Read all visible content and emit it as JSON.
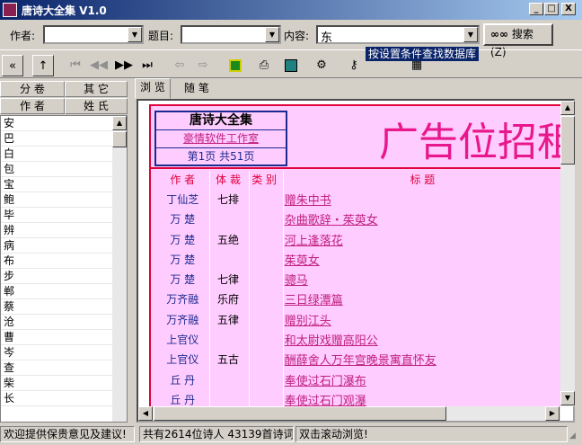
{
  "window": {
    "title": "唐诗大全集 V1.0",
    "min": "_",
    "max": "□",
    "close": "X"
  },
  "search": {
    "author_label": "作者:",
    "author_value": "",
    "title_label": "题目:",
    "title_value": "",
    "content_label": "内容:",
    "content_value": "东",
    "button_label": "搜索 (Z)",
    "tooltip": "按设置条件查找数据库"
  },
  "toolbar": {
    "icons": [
      "back-icon",
      "up-icon",
      "first-icon",
      "prev-icon",
      "next-icon",
      "last-icon",
      "nav-back-icon",
      "nav-forward-icon",
      "book-icon",
      "print-icon",
      "network-icon",
      "gear-icon",
      "key-icon",
      "calendar-icon"
    ]
  },
  "left_panel": {
    "tab1a": "分  卷",
    "tab1b": "其  它",
    "tab2a": "作  者",
    "tab2b": "姓  氏",
    "chars": [
      "安",
      "巴",
      "白",
      "包",
      "宝",
      "鲍",
      "毕",
      "辨",
      "病",
      "布",
      "步",
      "郸",
      "蔡",
      "沧",
      "曹",
      "岑",
      "查",
      "柴",
      "长"
    ]
  },
  "right_tabs": {
    "browse": "浏 览",
    "notes": "随 笔"
  },
  "brand": {
    "title": "唐诗大全集",
    "studio": "豪情软件工作室",
    "page": "第1页 共51页"
  },
  "ad_text": "广告位招租",
  "table": {
    "headers": [
      "作 者",
      "体 裁",
      "类 别",
      "标   题"
    ],
    "rows": [
      {
        "author": "丁仙芝",
        "form": "七排",
        "cat": "",
        "title": "赠朱中书"
      },
      {
        "author": "万  楚",
        "form": "",
        "cat": "",
        "title": "杂曲歌辞・茱萸女"
      },
      {
        "author": "万  楚",
        "form": "五绝",
        "cat": "",
        "title": "河上逢落花"
      },
      {
        "author": "万  楚",
        "form": "",
        "cat": "",
        "title": "茱萸女"
      },
      {
        "author": "万  楚",
        "form": "七律",
        "cat": "",
        "title": "骢马"
      },
      {
        "author": "万齐融",
        "form": "乐府",
        "cat": "",
        "title": "三日绿潭篇"
      },
      {
        "author": "万齐融",
        "form": "五律",
        "cat": "",
        "title": "赠别江头"
      },
      {
        "author": "上官仪",
        "form": "",
        "cat": "",
        "title": "和太尉戏赠高阳公"
      },
      {
        "author": "上官仪",
        "form": "五古",
        "cat": "",
        "title": "酬薛舍人万年宫晚景寓直怀友"
      },
      {
        "author": "丘  丹",
        "form": "",
        "cat": "",
        "title": "奉使过石门瀑布"
      },
      {
        "author": "丘  丹",
        "form": "",
        "cat": "",
        "title": "奉使过石门观瀑"
      }
    ]
  },
  "status": {
    "left": "欢迎提供保贵意见及建议!",
    "middle": "共有2614位诗人 43139首诗词",
    "right": "双击滚动浏览!"
  },
  "colors": {
    "accent_red": "#e0003c",
    "link_pink": "#c02080",
    "author_blue": "#1c2a8f",
    "panel_pink": "#ffccff"
  }
}
